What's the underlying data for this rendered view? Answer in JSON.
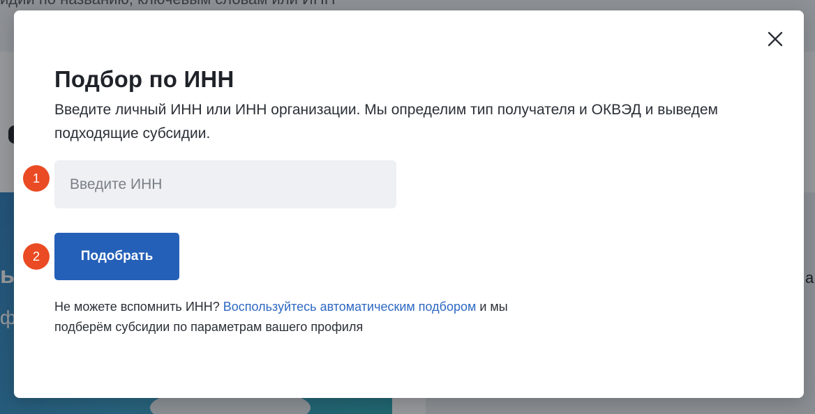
{
  "background": {
    "search_text": "идии по названию, ключевым словам или ИНН",
    "banner_glyph_1": "ы",
    "banner_glyph_2": "ф",
    "right_glyph": "а"
  },
  "modal": {
    "title": "Подбор по ИНН",
    "description": "Введите личный ИНН или ИНН организации. Мы определим тип получателя и ОКВЭД и выведем подходящие субсидии.",
    "close_icon": "close-icon",
    "steps": [
      "1",
      "2"
    ],
    "inn_input": {
      "placeholder": "Введите ИНН",
      "value": ""
    },
    "submit_label": "Подобрать",
    "hint": {
      "prefix": "Не можете вспомнить ИНН? ",
      "link_text": "Воспользуйтесь автоматическим подбором",
      "suffix": " и мы подберём субсидии по параметрам вашего профиля"
    }
  },
  "colors": {
    "accent_button": "#2560b8",
    "link": "#2e68c2",
    "step_badge": "#ea4b24",
    "input_background": "#eef0f3"
  }
}
